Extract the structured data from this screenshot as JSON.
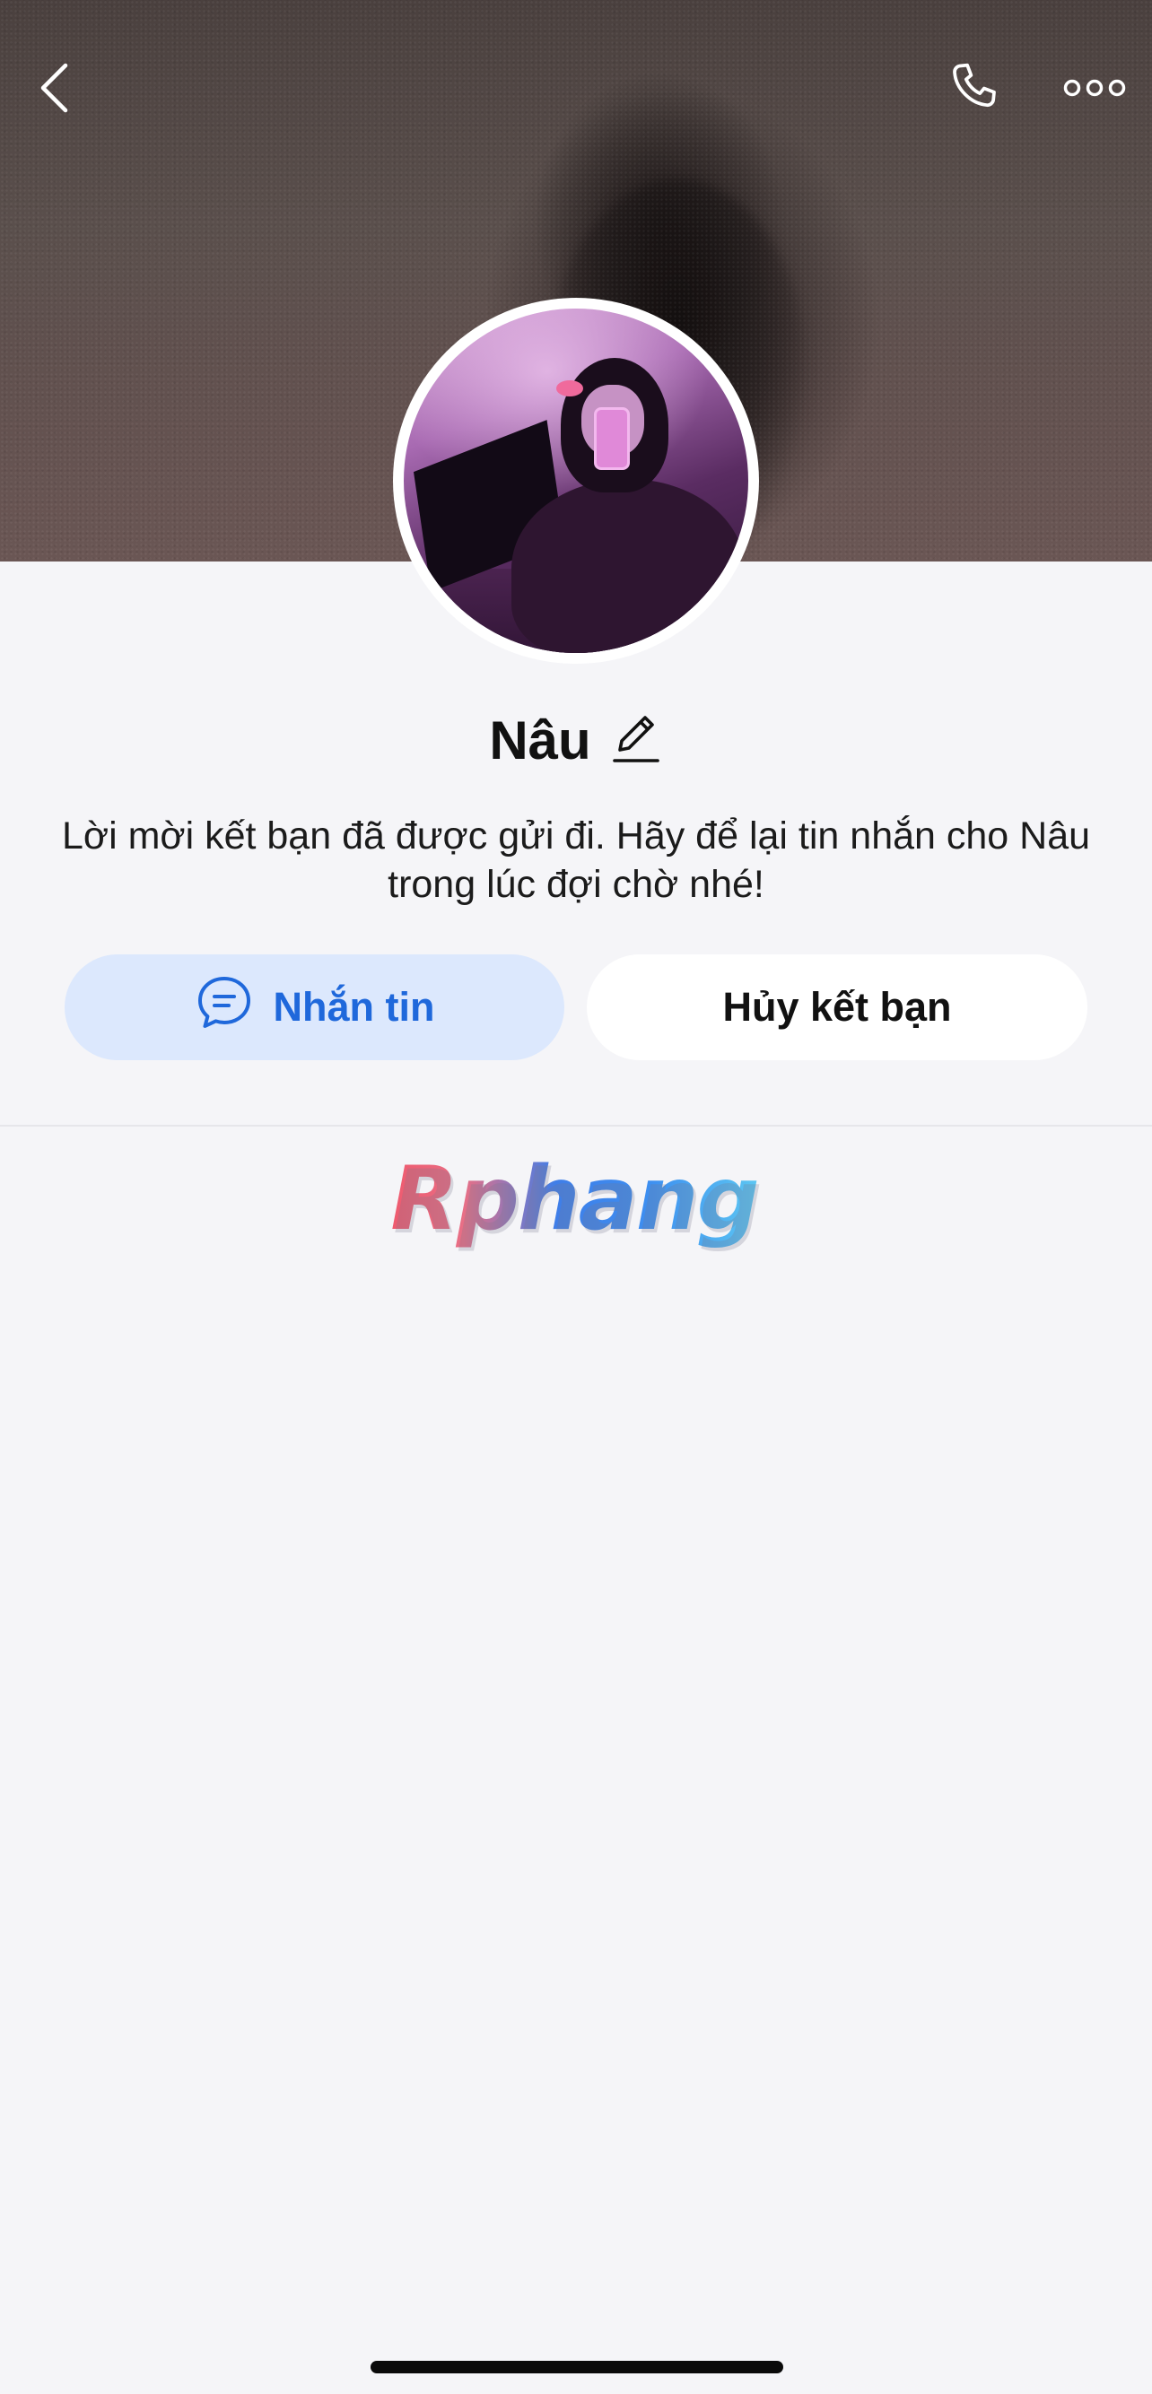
{
  "profile": {
    "name": "Nâu",
    "info_text": "Lời mời kết bạn đã được gửi đi. Hãy để lại tin nhắn cho Nâu trong lúc đợi chờ nhé!"
  },
  "actions": {
    "message_label": "Nhắn tin",
    "cancel_friend_label": "Hủy kết bạn"
  },
  "watermark": {
    "text": "Rphang"
  },
  "icons": {
    "back": "chevron-left-icon",
    "call": "phone-icon",
    "more": "more-horizontal-icon",
    "edit": "pencil-icon",
    "message": "chat-bubble-icon"
  },
  "colors": {
    "accent": "#1f68db",
    "message_button_bg": "#dce8fd",
    "background": "#f5f5f8"
  }
}
